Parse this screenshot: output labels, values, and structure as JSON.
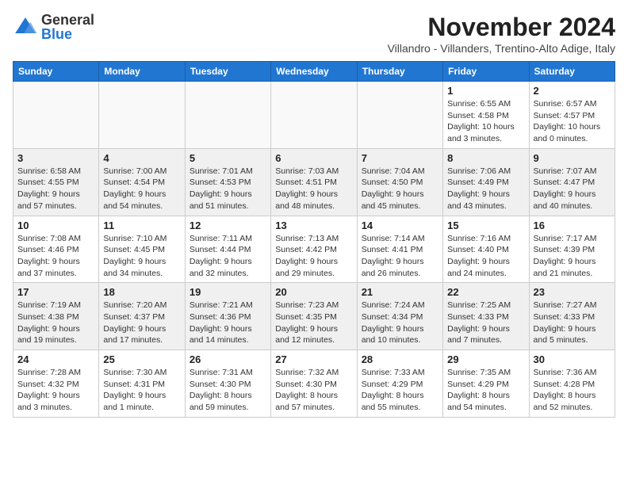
{
  "logo": {
    "general": "General",
    "blue": "Blue"
  },
  "title": "November 2024",
  "subtitle": "Villandro - Villanders, Trentino-Alto Adige, Italy",
  "weekdays": [
    "Sunday",
    "Monday",
    "Tuesday",
    "Wednesday",
    "Thursday",
    "Friday",
    "Saturday"
  ],
  "weeks": [
    [
      {
        "day": "",
        "info": "",
        "empty": true
      },
      {
        "day": "",
        "info": "",
        "empty": true
      },
      {
        "day": "",
        "info": "",
        "empty": true
      },
      {
        "day": "",
        "info": "",
        "empty": true
      },
      {
        "day": "",
        "info": "",
        "empty": true
      },
      {
        "day": "1",
        "info": "Sunrise: 6:55 AM\nSunset: 4:58 PM\nDaylight: 10 hours and 3 minutes."
      },
      {
        "day": "2",
        "info": "Sunrise: 6:57 AM\nSunset: 4:57 PM\nDaylight: 10 hours and 0 minutes."
      }
    ],
    [
      {
        "day": "3",
        "info": "Sunrise: 6:58 AM\nSunset: 4:55 PM\nDaylight: 9 hours and 57 minutes."
      },
      {
        "day": "4",
        "info": "Sunrise: 7:00 AM\nSunset: 4:54 PM\nDaylight: 9 hours and 54 minutes."
      },
      {
        "day": "5",
        "info": "Sunrise: 7:01 AM\nSunset: 4:53 PM\nDaylight: 9 hours and 51 minutes."
      },
      {
        "day": "6",
        "info": "Sunrise: 7:03 AM\nSunset: 4:51 PM\nDaylight: 9 hours and 48 minutes."
      },
      {
        "day": "7",
        "info": "Sunrise: 7:04 AM\nSunset: 4:50 PM\nDaylight: 9 hours and 45 minutes."
      },
      {
        "day": "8",
        "info": "Sunrise: 7:06 AM\nSunset: 4:49 PM\nDaylight: 9 hours and 43 minutes."
      },
      {
        "day": "9",
        "info": "Sunrise: 7:07 AM\nSunset: 4:47 PM\nDaylight: 9 hours and 40 minutes."
      }
    ],
    [
      {
        "day": "10",
        "info": "Sunrise: 7:08 AM\nSunset: 4:46 PM\nDaylight: 9 hours and 37 minutes."
      },
      {
        "day": "11",
        "info": "Sunrise: 7:10 AM\nSunset: 4:45 PM\nDaylight: 9 hours and 34 minutes."
      },
      {
        "day": "12",
        "info": "Sunrise: 7:11 AM\nSunset: 4:44 PM\nDaylight: 9 hours and 32 minutes."
      },
      {
        "day": "13",
        "info": "Sunrise: 7:13 AM\nSunset: 4:42 PM\nDaylight: 9 hours and 29 minutes."
      },
      {
        "day": "14",
        "info": "Sunrise: 7:14 AM\nSunset: 4:41 PM\nDaylight: 9 hours and 26 minutes."
      },
      {
        "day": "15",
        "info": "Sunrise: 7:16 AM\nSunset: 4:40 PM\nDaylight: 9 hours and 24 minutes."
      },
      {
        "day": "16",
        "info": "Sunrise: 7:17 AM\nSunset: 4:39 PM\nDaylight: 9 hours and 21 minutes."
      }
    ],
    [
      {
        "day": "17",
        "info": "Sunrise: 7:19 AM\nSunset: 4:38 PM\nDaylight: 9 hours and 19 minutes."
      },
      {
        "day": "18",
        "info": "Sunrise: 7:20 AM\nSunset: 4:37 PM\nDaylight: 9 hours and 17 minutes."
      },
      {
        "day": "19",
        "info": "Sunrise: 7:21 AM\nSunset: 4:36 PM\nDaylight: 9 hours and 14 minutes."
      },
      {
        "day": "20",
        "info": "Sunrise: 7:23 AM\nSunset: 4:35 PM\nDaylight: 9 hours and 12 minutes."
      },
      {
        "day": "21",
        "info": "Sunrise: 7:24 AM\nSunset: 4:34 PM\nDaylight: 9 hours and 10 minutes."
      },
      {
        "day": "22",
        "info": "Sunrise: 7:25 AM\nSunset: 4:33 PM\nDaylight: 9 hours and 7 minutes."
      },
      {
        "day": "23",
        "info": "Sunrise: 7:27 AM\nSunset: 4:33 PM\nDaylight: 9 hours and 5 minutes."
      }
    ],
    [
      {
        "day": "24",
        "info": "Sunrise: 7:28 AM\nSunset: 4:32 PM\nDaylight: 9 hours and 3 minutes."
      },
      {
        "day": "25",
        "info": "Sunrise: 7:30 AM\nSunset: 4:31 PM\nDaylight: 9 hours and 1 minute."
      },
      {
        "day": "26",
        "info": "Sunrise: 7:31 AM\nSunset: 4:30 PM\nDaylight: 8 hours and 59 minutes."
      },
      {
        "day": "27",
        "info": "Sunrise: 7:32 AM\nSunset: 4:30 PM\nDaylight: 8 hours and 57 minutes."
      },
      {
        "day": "28",
        "info": "Sunrise: 7:33 AM\nSunset: 4:29 PM\nDaylight: 8 hours and 55 minutes."
      },
      {
        "day": "29",
        "info": "Sunrise: 7:35 AM\nSunset: 4:29 PM\nDaylight: 8 hours and 54 minutes."
      },
      {
        "day": "30",
        "info": "Sunrise: 7:36 AM\nSunset: 4:28 PM\nDaylight: 8 hours and 52 minutes."
      }
    ]
  ]
}
